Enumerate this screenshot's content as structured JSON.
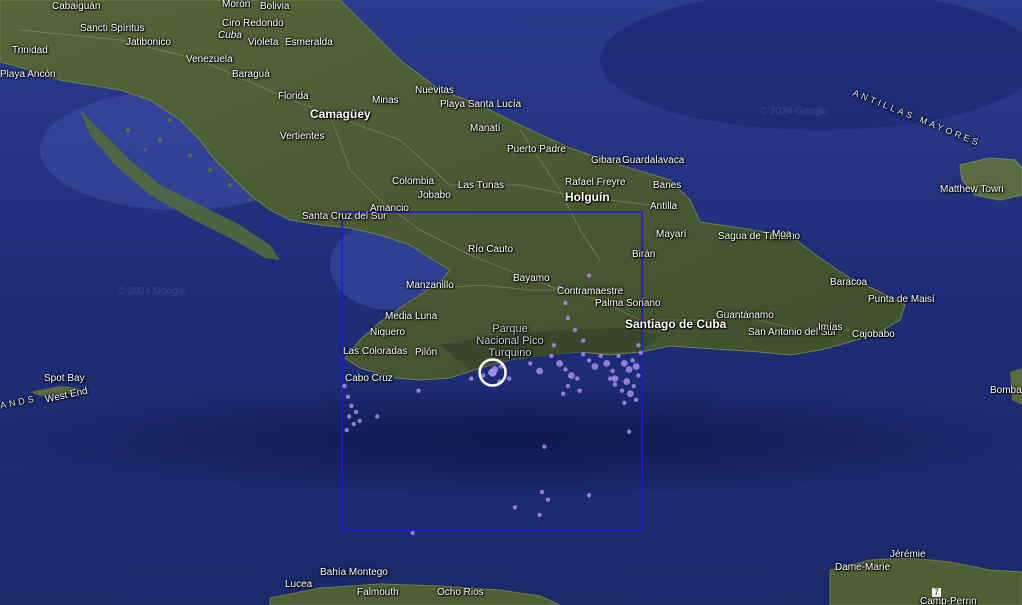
{
  "map": {
    "watermark": "© 2024 Google",
    "selection_color": "#1a1adf",
    "quake_color": "#a98bf0",
    "labels": [
      {
        "id": "cabaiguan",
        "text": "Cabaiguán"
      },
      {
        "id": "moron",
        "text": "Morón"
      },
      {
        "id": "bolivia",
        "text": "Bolivia"
      },
      {
        "id": "sancti",
        "text": "Sancti Spíritus"
      },
      {
        "id": "ciro",
        "text": "Ciro Redondo"
      },
      {
        "id": "cuba",
        "text": "Cuba"
      },
      {
        "id": "trinidad",
        "text": "Trinidad"
      },
      {
        "id": "jatibonico",
        "text": "Jatibonico"
      },
      {
        "id": "violeta",
        "text": "Violeta"
      },
      {
        "id": "esmeralda",
        "text": "Esmeralda"
      },
      {
        "id": "venezuela",
        "text": "Venezuela"
      },
      {
        "id": "baragua",
        "text": "Baraguá"
      },
      {
        "id": "playaancon",
        "text": "Playa Ancón"
      },
      {
        "id": "florida",
        "text": "Florida"
      },
      {
        "id": "nuevitas",
        "text": "Nuevitas"
      },
      {
        "id": "minas",
        "text": "Minas"
      },
      {
        "id": "playasanta",
        "text": "Playa Santa Lucía"
      },
      {
        "id": "camaguey",
        "text": "Camagüey"
      },
      {
        "id": "manati",
        "text": "Manatí"
      },
      {
        "id": "vertientes",
        "text": "Vertientes"
      },
      {
        "id": "puertopadre",
        "text": "Puerto Padre"
      },
      {
        "id": "gibara",
        "text": "Gibara"
      },
      {
        "id": "guardalavaca",
        "text": "Guardalavaca"
      },
      {
        "id": "colombia",
        "text": "Colombia"
      },
      {
        "id": "rafael",
        "text": "Rafael Freyre"
      },
      {
        "id": "lastunas",
        "text": "Las Tunas"
      },
      {
        "id": "banes",
        "text": "Banes"
      },
      {
        "id": "jobabo",
        "text": "Jobabo"
      },
      {
        "id": "holguin",
        "text": "Holguín"
      },
      {
        "id": "antilla",
        "text": "Antilla"
      },
      {
        "id": "amancio",
        "text": "Amancio"
      },
      {
        "id": "santacruz",
        "text": "Santa Cruz del Sur"
      },
      {
        "id": "mayari",
        "text": "Mayarí"
      },
      {
        "id": "sagua",
        "text": "Sagua de Tánamo"
      },
      {
        "id": "moa",
        "text": "Moa"
      },
      {
        "id": "riocauto",
        "text": "Río Cauto"
      },
      {
        "id": "biran",
        "text": "Birán"
      },
      {
        "id": "baracoa",
        "text": "Baracoa"
      },
      {
        "id": "manzanillo",
        "text": "Manzanillo"
      },
      {
        "id": "bayamo",
        "text": "Bayamo"
      },
      {
        "id": "contramaestre",
        "text": "Contramaestre"
      },
      {
        "id": "puntamaisi",
        "text": "Punta de Maisí"
      },
      {
        "id": "palmasoriano",
        "text": "Palma Soriano"
      },
      {
        "id": "medialuna",
        "text": "Media Luna"
      },
      {
        "id": "santiago",
        "text": "Santiago de Cuba"
      },
      {
        "id": "guantanamo",
        "text": "Guantánamo"
      },
      {
        "id": "parque",
        "text": "Parque Nacional Pico Turquino"
      },
      {
        "id": "niquero",
        "text": "Niquero"
      },
      {
        "id": "sanantonio",
        "text": "San Antonio del Sur"
      },
      {
        "id": "imias",
        "text": "Imías"
      },
      {
        "id": "cajobabo",
        "text": "Cajobabo"
      },
      {
        "id": "lascoloradas",
        "text": "Las Coloradas"
      },
      {
        "id": "pilon",
        "text": "Pilón"
      },
      {
        "id": "cabocruz",
        "text": "Cabo Cruz"
      },
      {
        "id": "spotbay",
        "text": "Spot Bay"
      },
      {
        "id": "westend",
        "text": "West End"
      },
      {
        "id": "islands",
        "text": "ANDS"
      },
      {
        "id": "antillas",
        "text": "ANTILLAS MAYORES"
      },
      {
        "id": "matthew",
        "text": "Matthew Town"
      },
      {
        "id": "bomba",
        "text": "Bomba"
      },
      {
        "id": "jeremie",
        "text": "Jérémie"
      },
      {
        "id": "damemarie",
        "text": "Dame-Marie"
      },
      {
        "id": "bahia",
        "text": "Bahía Montego"
      },
      {
        "id": "lucea",
        "text": "Lucea"
      },
      {
        "id": "falmouth",
        "text": "Falmouth"
      },
      {
        "id": "ochorios",
        "text": "Ocho Rios"
      },
      {
        "id": "route7",
        "text": "7"
      },
      {
        "id": "campperrin",
        "text": "Camp-Perrin"
      }
    ],
    "earthquakes": [
      {
        "lon": -77.1,
        "lat": 19.86,
        "mag": 3
      },
      {
        "lon": -77.14,
        "lat": 19.84,
        "mag": 2
      },
      {
        "lon": -77.05,
        "lat": 19.88,
        "mag": 2
      },
      {
        "lon": -77.2,
        "lat": 19.82,
        "mag": 2
      },
      {
        "lon": -77.3,
        "lat": 19.8,
        "mag": 2
      },
      {
        "lon": -76.98,
        "lat": 19.8,
        "mag": 2
      },
      {
        "lon": -77.06,
        "lat": 19.78,
        "mag": 2
      },
      {
        "lon": -76.72,
        "lat": 19.85,
        "mag": 3
      },
      {
        "lon": -76.8,
        "lat": 19.9,
        "mag": 2
      },
      {
        "lon": -76.62,
        "lat": 19.95,
        "mag": 2
      },
      {
        "lon": -76.55,
        "lat": 19.9,
        "mag": 3
      },
      {
        "lon": -76.5,
        "lat": 19.86,
        "mag": 2
      },
      {
        "lon": -76.45,
        "lat": 19.82,
        "mag": 3
      },
      {
        "lon": -76.4,
        "lat": 19.8,
        "mag": 2
      },
      {
        "lon": -76.48,
        "lat": 19.75,
        "mag": 2
      },
      {
        "lon": -76.52,
        "lat": 19.7,
        "mag": 2
      },
      {
        "lon": -76.38,
        "lat": 19.72,
        "mag": 2
      },
      {
        "lon": -76.3,
        "lat": 19.92,
        "mag": 2
      },
      {
        "lon": -76.25,
        "lat": 19.88,
        "mag": 3
      },
      {
        "lon": -76.2,
        "lat": 19.95,
        "mag": 2
      },
      {
        "lon": -76.15,
        "lat": 19.9,
        "mag": 3
      },
      {
        "lon": -76.1,
        "lat": 19.85,
        "mag": 2
      },
      {
        "lon": -76.05,
        "lat": 19.95,
        "mag": 2
      },
      {
        "lon": -76.0,
        "lat": 19.9,
        "mag": 3
      },
      {
        "lon": -75.96,
        "lat": 19.86,
        "mag": 3
      },
      {
        "lon": -75.93,
        "lat": 19.92,
        "mag": 2
      },
      {
        "lon": -75.9,
        "lat": 19.88,
        "mag": 3
      },
      {
        "lon": -75.88,
        "lat": 19.82,
        "mag": 2
      },
      {
        "lon": -75.86,
        "lat": 19.97,
        "mag": 2
      },
      {
        "lon": -75.98,
        "lat": 19.78,
        "mag": 3
      },
      {
        "lon": -76.02,
        "lat": 19.72,
        "mag": 2
      },
      {
        "lon": -75.95,
        "lat": 19.7,
        "mag": 3
      },
      {
        "lon": -75.92,
        "lat": 19.75,
        "mag": 2
      },
      {
        "lon": -76.08,
        "lat": 19.76,
        "mag": 2
      },
      {
        "lon": -76.12,
        "lat": 19.8,
        "mag": 2
      },
      {
        "lon": -75.9,
        "lat": 19.66,
        "mag": 2
      },
      {
        "lon": -76.0,
        "lat": 19.64,
        "mag": 2
      },
      {
        "lon": -75.88,
        "lat": 20.02,
        "mag": 2
      },
      {
        "lon": -76.35,
        "lat": 20.05,
        "mag": 2
      },
      {
        "lon": -76.42,
        "lat": 20.12,
        "mag": 2
      },
      {
        "lon": -76.5,
        "lat": 20.3,
        "mag": 2
      },
      {
        "lon": -76.55,
        "lat": 20.4,
        "mag": 2
      },
      {
        "lon": -76.3,
        "lat": 20.48,
        "mag": 2
      },
      {
        "lon": -76.35,
        "lat": 19.96,
        "mag": 2
      },
      {
        "lon": -76.6,
        "lat": 20.02,
        "mag": 2
      },
      {
        "lon": -76.48,
        "lat": 20.2,
        "mag": 2
      },
      {
        "lon": -78.38,
        "lat": 19.75,
        "mag": 2
      },
      {
        "lon": -78.35,
        "lat": 19.68,
        "mag": 2
      },
      {
        "lon": -78.32,
        "lat": 19.62,
        "mag": 2
      },
      {
        "lon": -78.28,
        "lat": 19.58,
        "mag": 2
      },
      {
        "lon": -78.34,
        "lat": 19.55,
        "mag": 2
      },
      {
        "lon": -78.3,
        "lat": 19.5,
        "mag": 2
      },
      {
        "lon": -78.36,
        "lat": 19.46,
        "mag": 2
      },
      {
        "lon": -78.25,
        "lat": 19.52,
        "mag": 2
      },
      {
        "lon": -78.1,
        "lat": 19.55,
        "mag": 2
      },
      {
        "lon": -77.75,
        "lat": 19.72,
        "mag": 2
      },
      {
        "lon": -76.7,
        "lat": 19.05,
        "mag": 2
      },
      {
        "lon": -76.65,
        "lat": 19.0,
        "mag": 2
      },
      {
        "lon": -76.68,
        "lat": 19.35,
        "mag": 2
      },
      {
        "lon": -76.3,
        "lat": 19.03,
        "mag": 2
      },
      {
        "lon": -76.72,
        "lat": 18.9,
        "mag": 2
      },
      {
        "lon": -77.8,
        "lat": 18.78,
        "mag": 2
      },
      {
        "lon": -76.93,
        "lat": 18.95,
        "mag": 2
      },
      {
        "lon": -75.96,
        "lat": 19.45,
        "mag": 2
      },
      {
        "lon": -76.08,
        "lat": 19.8,
        "mag": 3
      }
    ],
    "highlight": {
      "lon": -77.12,
      "lat": 19.84
    },
    "bounds": {
      "lon_min": -78.4,
      "lon_max": -75.85,
      "lat_min": 18.8,
      "lat_max": 20.9
    }
  }
}
